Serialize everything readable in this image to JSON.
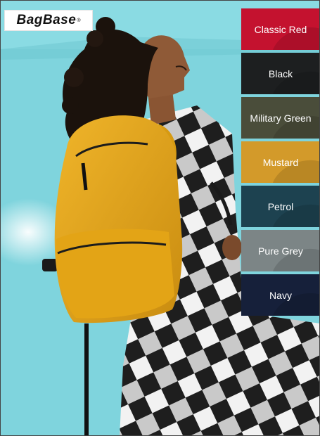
{
  "brand": {
    "logo_text": "BagBase",
    "registered_mark": "®"
  },
  "colors": {
    "background": "#7fd4dd",
    "backpack": "#e8a91b",
    "shirt_light": "#f2f2f2",
    "shirt_dark": "#1e1e1e"
  },
  "swatches": [
    {
      "label": "Classic Red",
      "color": "#c4122f"
    },
    {
      "label": "Black",
      "color": "#1d1f20"
    },
    {
      "label": "Military Green",
      "color": "#4a4d3a"
    },
    {
      "label": "Mustard",
      "color": "#d39a2a"
    },
    {
      "label": "Petrol",
      "color": "#1d4250"
    },
    {
      "label": "Pure Grey",
      "color": "#7c8586"
    },
    {
      "label": "Navy",
      "color": "#16203a"
    }
  ]
}
